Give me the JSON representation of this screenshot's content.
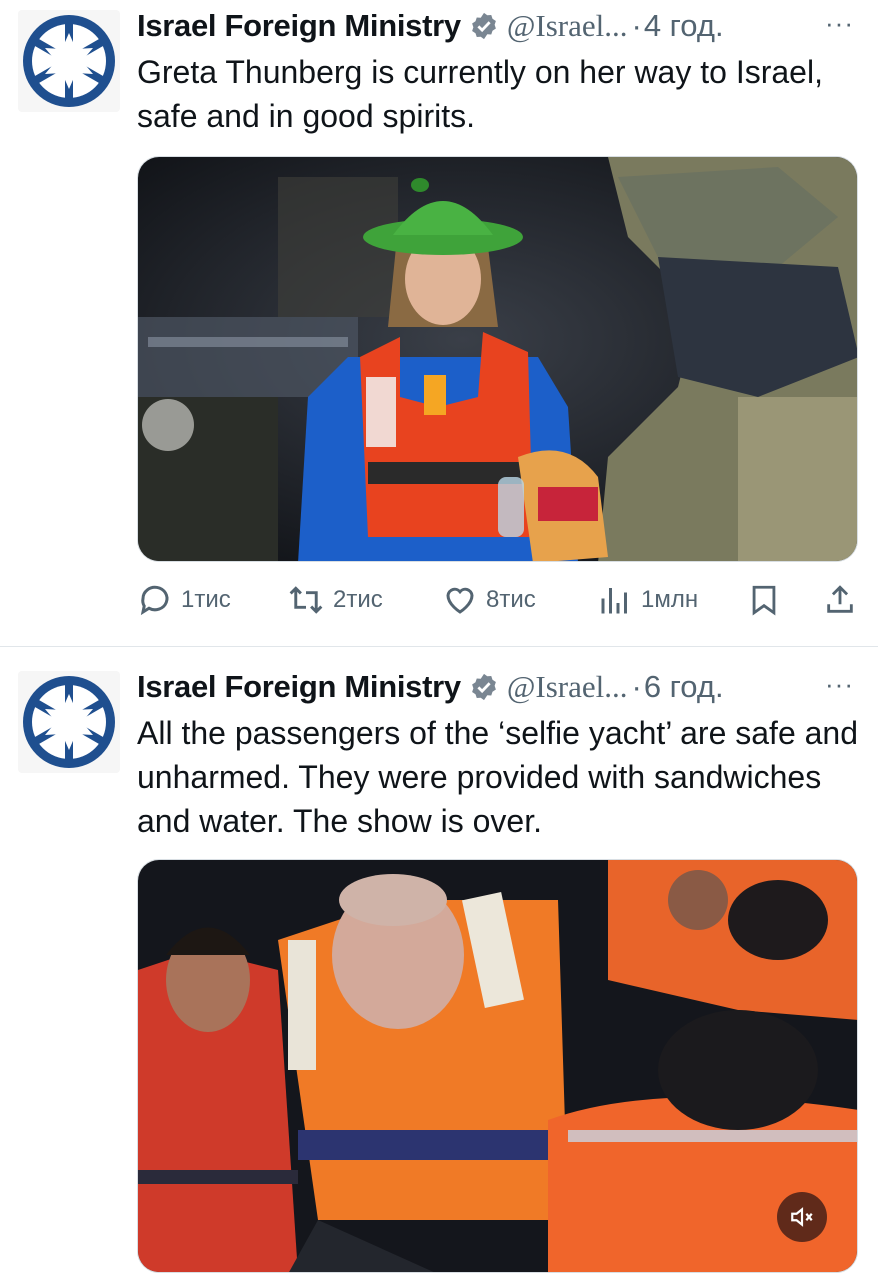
{
  "tweets": [
    {
      "author_name": "Israel Foreign Ministry",
      "handle": "@Israel...",
      "separator": "·",
      "time": "4 год.",
      "more": "···",
      "text": "Greta Thunberg is currently on her way to Israel, safe and in good spirits.",
      "stats": {
        "replies": "1тис",
        "reposts": "2тис",
        "likes": "8тис",
        "views": "1млн"
      }
    },
    {
      "author_name": "Israel Foreign Ministry",
      "handle": "@Israel...",
      "separator": "·",
      "time": "6 год.",
      "more": "···",
      "text": "All the passengers of the ‘selfie yacht’ are safe and unharmed. They were provided with sandwiches and water. The show is over."
    }
  ],
  "icons": {
    "verified": "verified-badge-icon",
    "reply": "reply-icon",
    "repost": "repost-icon",
    "like": "like-icon",
    "views": "views-icon",
    "bookmark": "bookmark-icon",
    "share": "share-icon",
    "mute": "mute-icon"
  },
  "colors": {
    "logo_blue": "#1f4f8f",
    "secondary_text": "#536471",
    "life_jacket": "#e8431f",
    "bucket_hat": "#3fa33a"
  }
}
